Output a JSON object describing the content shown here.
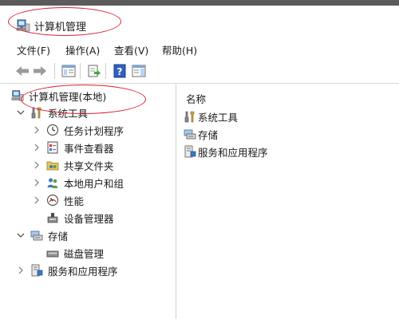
{
  "window": {
    "title": "计算机管理"
  },
  "menu": [
    "文件(F)",
    "操作(A)",
    "查看(V)",
    "帮助(H)"
  ],
  "tree": {
    "root": "计算机管理(本地)",
    "system_tools": {
      "label": "系统工具",
      "children": [
        "任务计划程序",
        "事件查看器",
        "共享文件夹",
        "本地用户和组",
        "性能",
        "设备管理器"
      ]
    },
    "storage": {
      "label": "存储",
      "children": [
        "磁盘管理"
      ]
    },
    "services": {
      "label": "服务和应用程序"
    }
  },
  "list": {
    "header": "名称",
    "items": [
      "系统工具",
      "存储",
      "服务和应用程序"
    ]
  },
  "icons": {
    "back": "back-arrow-icon",
    "forward": "forward-arrow-icon",
    "console_tree": "console-tree-icon",
    "export": "export-list-icon",
    "help": "help-icon",
    "action_pane": "action-pane-icon"
  },
  "colors": {
    "annotation": "#d9202f",
    "selection": "#cce8ff"
  }
}
